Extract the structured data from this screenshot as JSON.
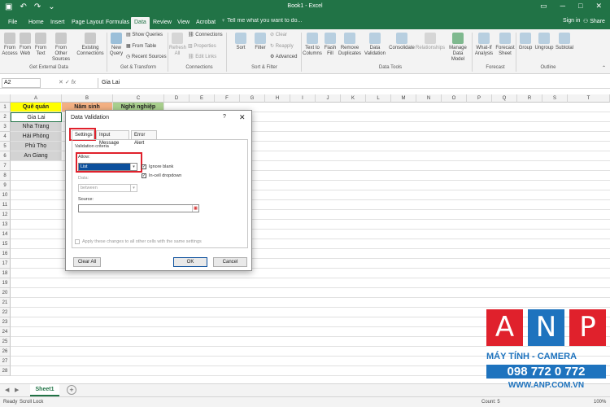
{
  "titlebar": {
    "title": "Book1 - Excel"
  },
  "tabs": [
    "File",
    "Home",
    "Insert",
    "Page Layout",
    "Formulas",
    "Data",
    "Review",
    "View",
    "Acrobat"
  ],
  "tellme": "Tell me what you want to do...",
  "signin": "Sign in",
  "share": "Share",
  "ribbon": {
    "get_external": {
      "access": "From Access",
      "web": "From Web",
      "text": "From Text",
      "other": "From Other Sources",
      "existing": "Existing Connections",
      "label": "Get External Data"
    },
    "transform": {
      "new_query": "New Query",
      "show_queries": "Show Queries",
      "from_table": "From Table",
      "recent": "Recent Sources",
      "label": "Get & Transform"
    },
    "connections": {
      "refresh": "Refresh All",
      "connections": "Connections",
      "properties": "Properties",
      "edit_links": "Edit Links",
      "label": "Connections"
    },
    "sort_filter": {
      "sort": "Sort",
      "filter": "Filter",
      "clear": "Clear",
      "reapply": "Reapply",
      "advanced": "Advanced",
      "label": "Sort & Filter"
    },
    "data_tools": {
      "text_to_columns": "Text to Columns",
      "flash_fill": "Flash Fill",
      "remove_dup": "Remove Duplicates",
      "validation": "Data Validation",
      "consolidate": "Consolidate",
      "relationships": "Relationships",
      "manage": "Manage Data Model",
      "label": "Data Tools"
    },
    "forecast": {
      "whatif": "What-If Analysis",
      "sheet": "Forecast Sheet",
      "label": "Forecast"
    },
    "outline": {
      "group": "Group",
      "ungroup": "Ungroup",
      "subtotal": "Subtotal",
      "label": "Outline"
    }
  },
  "formula_bar": {
    "namebox": "A2",
    "content": "Gia Lai"
  },
  "columns": [
    "A",
    "B",
    "C",
    "D",
    "E",
    "F",
    "G",
    "H",
    "I",
    "J",
    "K",
    "L",
    "M",
    "N",
    "O",
    "P",
    "Q",
    "R",
    "S",
    "T"
  ],
  "cells": {
    "a1": "Quê quán",
    "b1": "Năm sinh",
    "c1": "Nghề nghiệp",
    "a2": "Gia Lai",
    "a3": "Nha Trang",
    "a4": "Hải Phòng",
    "a5": "Phú Thọ",
    "a6": "An Giang"
  },
  "dialog": {
    "title": "Data Validation",
    "help": "?",
    "tabs": [
      "Settings",
      "Input Message",
      "Error Alert"
    ],
    "criteria_label": "Validation criteria",
    "allow_label": "Allow:",
    "allow_value": "List",
    "data_label": "Data:",
    "data_value": "between",
    "ignore_blank": "Ignore blank",
    "incell_dropdown": "In-cell dropdown",
    "source_label": "Source:",
    "source_value": "",
    "apply_changes": "Apply these changes to all other cells with the same settings",
    "clear_all": "Clear All",
    "ok": "OK",
    "cancel": "Cancel"
  },
  "sheet": {
    "tab": "Sheet1",
    "add": "+"
  },
  "status": {
    "ready": "Ready",
    "scroll": "Scroll Lock",
    "count": "Count: 5",
    "zoom": "100%"
  },
  "watermark": {
    "letters": [
      "A",
      "N",
      "P"
    ],
    "line1": "MÁY TÍNH - CAMERA",
    "phone": "098 772 0 772",
    "site": "WWW.ANP.COM.VN"
  },
  "colors": {
    "excel_green": "#217346",
    "header_yellow": "#FFFF00",
    "header_orange": "#F4B183",
    "header_green": "#A9D08E",
    "highlight_red": "#E0212C",
    "watermark_red": "#E0212C",
    "watermark_blue": "#1E73BE"
  }
}
